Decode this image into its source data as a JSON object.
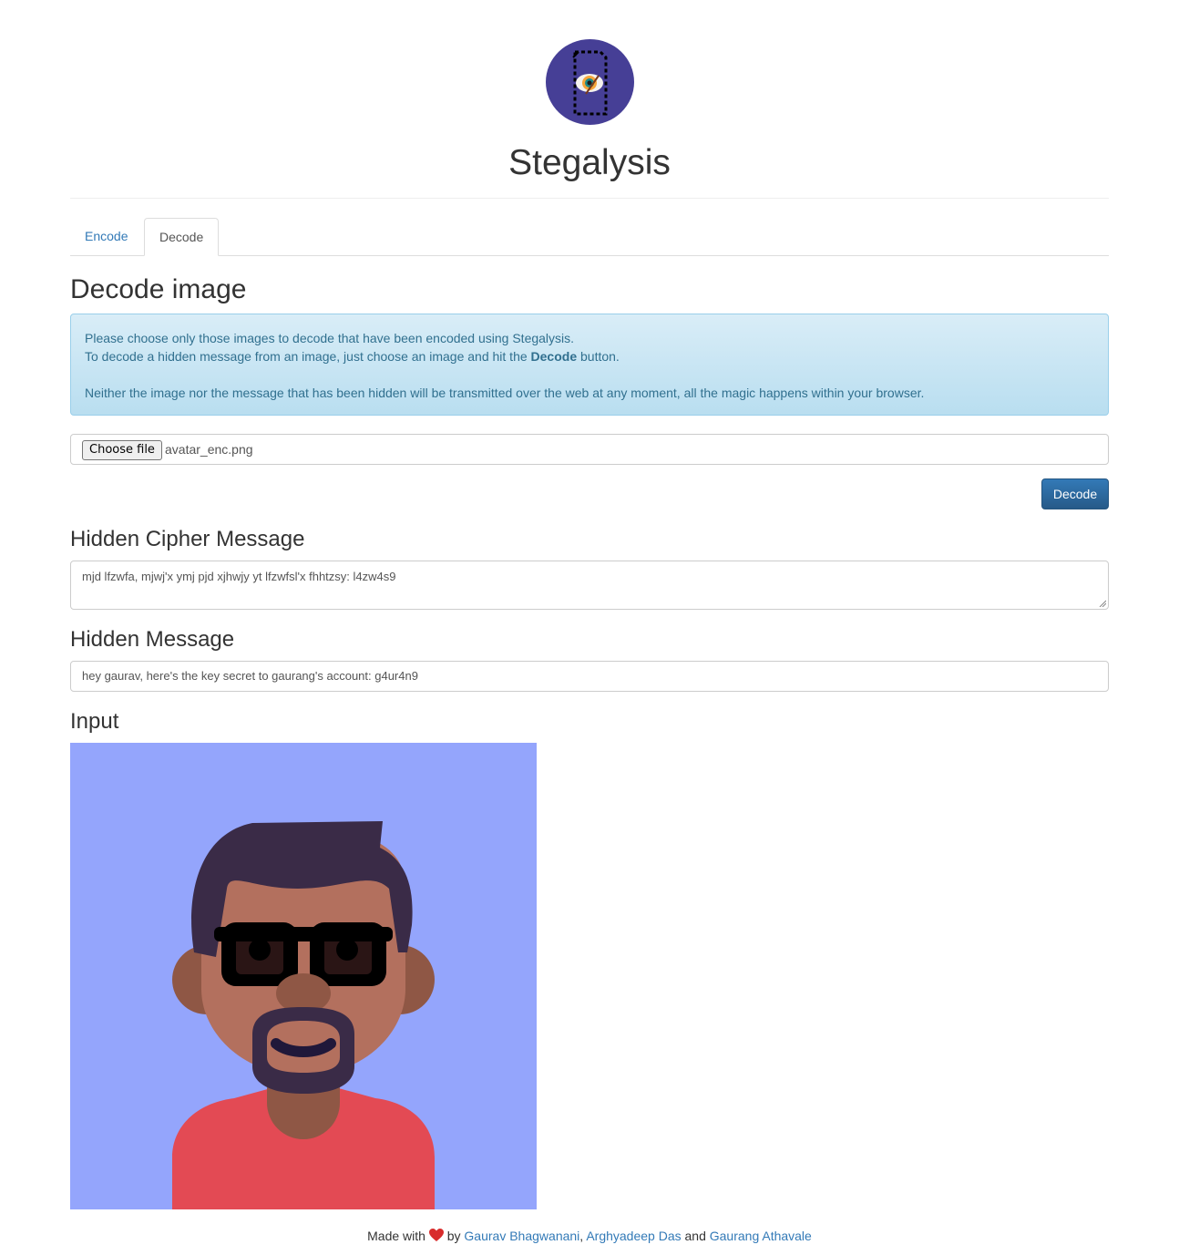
{
  "app": {
    "title": "Stegalysis"
  },
  "tabs": [
    {
      "label": "Encode"
    },
    {
      "label": "Decode"
    }
  ],
  "decode": {
    "heading": "Decode image",
    "info": {
      "line1": "Please choose only those images to decode that have been encoded using Stegalysis.",
      "line2_prefix": "To decode a hidden message from an image, just choose an image and hit the ",
      "line2_bold": "Decode",
      "line2_suffix": " button.",
      "line3": "Neither the image nor the message that has been hidden will be transmitted over the web at any moment, all the magic happens within your browser."
    },
    "file": {
      "button_label": "Choose file",
      "filename": "avatar_enc.png"
    },
    "decode_button": "Decode",
    "cipher_heading": "Hidden Cipher Message",
    "cipher_value": "mjd lfzwfa, mjwj'x ymj pjd xjhwjy yt lfzwfsl'x fhhtzsy: l4zw4s9",
    "hidden_heading": "Hidden Message",
    "hidden_value": "hey gaurav, here's the key secret to gaurang's account: g4ur4n9",
    "input_heading": "Input"
  },
  "footer": {
    "made_with": "Made with",
    "by": "by",
    "author1": "Gaurav Bhagwanani",
    "sep": ",",
    "author2": "Arghyadeep Das",
    "and": "and",
    "author3": "Gaurang Athavale"
  },
  "colors": {
    "link": "#337ab7",
    "logo_bg": "#463f96",
    "avatar_bg": "#94a5fc",
    "shirt": "#e34a54",
    "skin": "#b3705e",
    "hair": "#3a2b47"
  },
  "icons": {
    "logo": "eye-document-icon",
    "heart": "heart-icon"
  }
}
